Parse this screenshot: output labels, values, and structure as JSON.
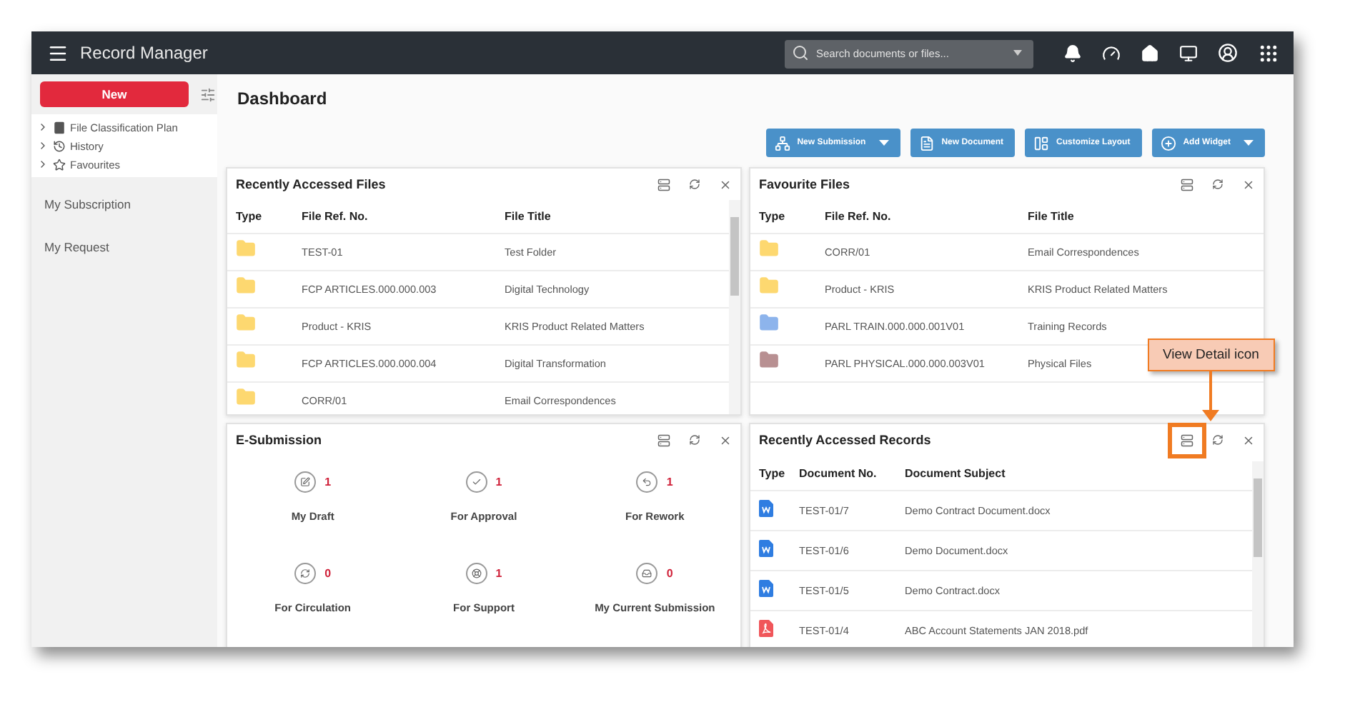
{
  "app": {
    "title": "Record Manager"
  },
  "search": {
    "placeholder": "Search documents or files..."
  },
  "sidebar": {
    "new_button": "New",
    "tree": [
      {
        "label": "File Classification Plan",
        "expanded": false
      },
      {
        "label": "History",
        "expanded": false
      },
      {
        "label": "Favourites",
        "expanded": false
      }
    ],
    "links": [
      "My Subscription",
      "My Request"
    ]
  },
  "page_title": "Dashboard",
  "toolbar": [
    {
      "label": "New Submission",
      "dropdown": true
    },
    {
      "label": "New Document",
      "dropdown": false
    },
    {
      "label": "Customize Layout",
      "dropdown": false
    },
    {
      "label": "Add Widget",
      "dropdown": true
    }
  ],
  "widgets": [
    {
      "kind": "files",
      "title": "Recently Accessed Files",
      "scrollbar": true,
      "view_detail_highlighted": false,
      "columns": [
        "Type",
        "File Ref. No.",
        "File Title"
      ],
      "rows": [
        {
          "color": "#fdd870",
          "ref": "TEST-01",
          "title": "Test Folder"
        },
        {
          "color": "#fdd870",
          "ref": "FCP ARTICLES.000.000.003",
          "title": "Digital Technology"
        },
        {
          "color": "#fdd870",
          "ref": "Product - KRIS",
          "title": "KRIS Product Related Matters"
        },
        {
          "color": "#fdd870",
          "ref": "FCP ARTICLES.000.000.004",
          "title": "Digital Transformation"
        },
        {
          "color": "#fdd870",
          "ref": "CORR/01",
          "title": "Email Correspondences"
        }
      ]
    },
    {
      "kind": "files",
      "title": "Favourite Files",
      "scrollbar": false,
      "view_detail_highlighted": false,
      "columns": [
        "Type",
        "File Ref. No.",
        "File Title"
      ],
      "rows": [
        {
          "color": "#fdd870",
          "ref": "CORR/01",
          "title": "Email Correspondences"
        },
        {
          "color": "#fdd870",
          "ref": "Product - KRIS",
          "title": "KRIS Product Related Matters"
        },
        {
          "color": "#8db4ec",
          "ref": "PARL TRAIN.000.000.001V01",
          "title": "Training Records"
        },
        {
          "color": "#b89092",
          "ref": "PARL PHYSICAL.000.000.003V01",
          "title": "Physical Files"
        }
      ]
    },
    {
      "kind": "submission",
      "title": "E-Submission",
      "scrollbar": false,
      "view_detail_highlighted": false,
      "items": [
        {
          "label": "My Draft",
          "count": "1"
        },
        {
          "label": "For Approval",
          "count": "1"
        },
        {
          "label": "For Rework",
          "count": "1"
        },
        {
          "label": "For Circulation",
          "count": "0"
        },
        {
          "label": "For Support",
          "count": "1"
        },
        {
          "label": "My Current Submission",
          "count": "0"
        }
      ]
    },
    {
      "kind": "records",
      "title": "Recently Accessed Records",
      "scrollbar": true,
      "view_detail_highlighted": true,
      "columns": [
        "Type",
        "Document No.",
        "Document Subject"
      ],
      "rows": [
        {
          "kind": "word",
          "number": "TEST-01/7",
          "subject": "Demo Contract Document.docx"
        },
        {
          "kind": "word",
          "number": "TEST-01/6",
          "subject": "Demo Document.docx"
        },
        {
          "kind": "word",
          "number": "TEST-01/5",
          "subject": "Demo Contract.docx"
        },
        {
          "kind": "pdf",
          "number": "TEST-01/4",
          "subject": "ABC Account Statements JAN 2018.pdf"
        }
      ]
    }
  ],
  "callout": {
    "text": "View Detail icon"
  }
}
